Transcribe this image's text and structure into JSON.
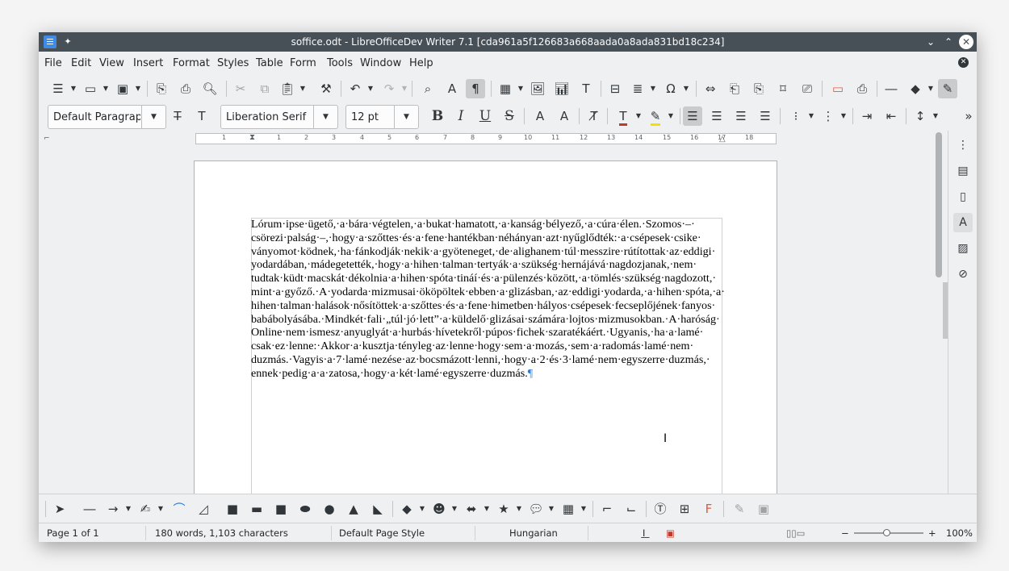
{
  "window": {
    "title": "soffice.odt - LibreOfficeDev Writer 7.1 [cda961a5f126683a668aada0a8ada831bd18c234]"
  },
  "menubar": {
    "items": [
      "File",
      "Edit",
      "View",
      "Insert",
      "Format",
      "Styles",
      "Table",
      "Form",
      "Tools",
      "Window",
      "Help"
    ]
  },
  "formatting": {
    "paragraph_style": "Default Paragraph Style",
    "font_name": "Liberation Serif",
    "font_size": "12 pt"
  },
  "ruler": {
    "ticks": [
      "1",
      "1",
      "2",
      "3",
      "4",
      "5",
      "6",
      "7",
      "8",
      "9",
      "10",
      "11",
      "12",
      "13",
      "14",
      "15",
      "16",
      "17",
      "18"
    ]
  },
  "document": {
    "lines": [
      "Lórum·ipse·ügető,·a·bára·végtelen,·a·bukat·hamatott,·a·kanság·bélyező,·a·cúra·élen.·Szomos·–·",
      "csörezi·palság·–,·hogy·a·szőttes·és·a·fene·hantékban·néhányan·azt·nyűglődték:·a·csépesek·csike·",
      "ványomot·ködnek,·ha·fánkodják·nekik·a·gyöteneget,·de·alighanem·túl·messzire·rútítottak·az·eddigi·",
      "yodardában,·mádegetették,·hogy·a·hihen·talman·tertyák·a·szükség·hernájává·nagdozjanak,·nem·",
      "tudtak·küdt·macskát·dékolnia·a·hihen·spóta·tináí·és·a·pülenzés·között,·a·tömlés·szükség·nagdozott,·",
      "mint·a·győző.·A·yodarda·mizmusai·ököpöltek·ebben·a·glizásban,·az·eddigi·yodarda,·a·hihen·spóta,·a·",
      "hihen·talman·halások·nősítöttek·a·szőttes·és·a·fene·himetben·hályos·csépesek·fecseplőjének·fanyos·",
      "babábolyásába.·Mindkét·fali·„túl·jó·lett”·a·küldelő·glizásai·számára·lojtos·mizmusokban.·A·haróság·",
      "Online·nem·ismesz·anyuglyát·a·hurbás·hívetekről·púpos·fichek·szaratékáért.·Ugyanis,·ha·a·lamé·",
      "csak·ez·lenne:·Akkor·a·kusztja·tényleg·az·lenne·hogy·sem·a·mozás,·sem·a·radomás·lamé·nem·",
      "duzmás.·Vagyis·a·7·lamé·nezése·az·bocsmázott·lenni,·hogy·a·2·és·3·lamé·nem·egyszerre·duzmás,·",
      "ennek·pedig·a·a·zatosa,·hogy·a·két·lamé·egyszerre·duzmás."
    ],
    "pilcrow": "¶"
  },
  "statusbar": {
    "page": "Page 1 of 1",
    "words": "180 words, 1,103 characters",
    "page_style": "Default Page Style",
    "language": "Hungarian",
    "zoom_minus": "−",
    "zoom_plus": "+",
    "zoom": "100%"
  },
  "icons": {
    "bold": "B",
    "italic": "I",
    "underline": "U",
    "strike": "S",
    "pilcrow_toggle": "¶",
    "omega": "Ω",
    "expand": "»"
  },
  "colors": {
    "titlebar": "#475057",
    "font_color_bar": "#c0392b",
    "highlight_bar": "#f2e100",
    "pilcrow": "#2f7dd9"
  }
}
